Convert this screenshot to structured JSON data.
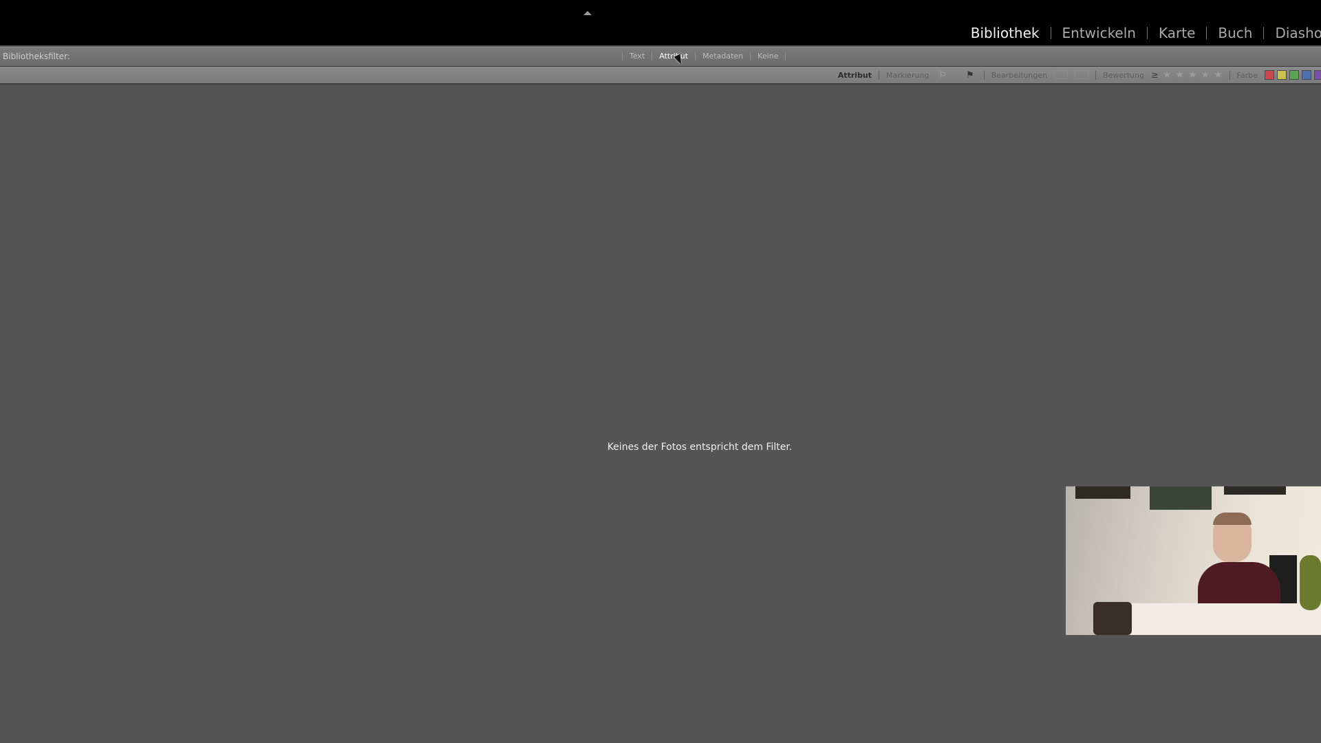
{
  "header": {
    "modules": [
      {
        "label": "Bibliothek",
        "active": true
      },
      {
        "label": "Entwickeln",
        "active": false
      },
      {
        "label": "Karte",
        "active": false
      },
      {
        "label": "Buch",
        "active": false
      },
      {
        "label": "Diasho",
        "active": false
      }
    ]
  },
  "filter_bar": {
    "label": "Bibliotheksfilter:",
    "tabs": [
      {
        "label": "Text",
        "active": false
      },
      {
        "label": "Attribut",
        "active": true
      },
      {
        "label": "Metadaten",
        "active": false
      },
      {
        "label": "Keine",
        "active": false
      }
    ]
  },
  "attribute_bar": {
    "title": "Attribut",
    "flag_label": "Markierung",
    "edits_label": "Bearbeitungen",
    "rating_label": "Bewertung",
    "rating_operator": "≥",
    "star_count": 5,
    "color_label": "Farbe",
    "color_swatches": [
      "#c8484f",
      "#c9c250",
      "#5aa455",
      "#4f6fb0",
      "#7a4fa8"
    ]
  },
  "main": {
    "empty_message": "Keines der Fotos entspricht dem Filter."
  },
  "icons": {
    "collapse": "triangle-up",
    "unflagged": "flag-outline",
    "pick": "flag-filled",
    "star": "★"
  }
}
